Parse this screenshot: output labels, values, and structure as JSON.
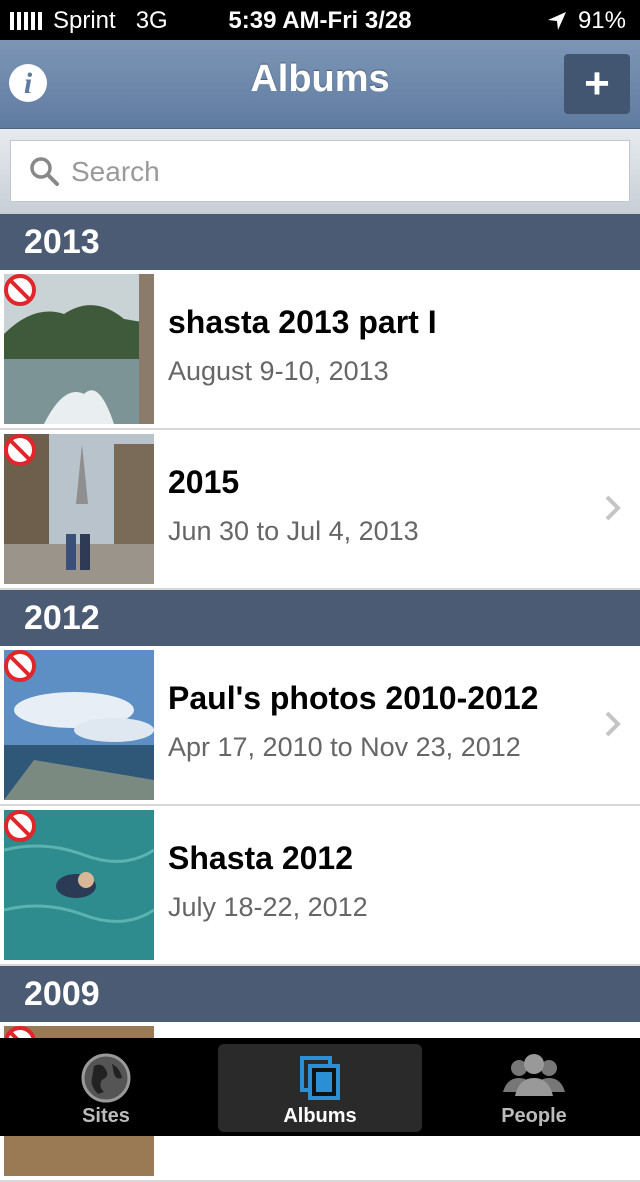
{
  "status_bar": {
    "carrier": "Sprint",
    "network": "3G",
    "time": "5:39 AM-Fri 3/28",
    "battery": "91%"
  },
  "nav": {
    "title": "Albums",
    "info_icon": "info-icon",
    "add_label": "+"
  },
  "search": {
    "placeholder": "Search"
  },
  "sections": [
    {
      "year": "2013",
      "albums": [
        {
          "title": "shasta 2013 part I",
          "date": "August 9-10, 2013",
          "chevron": false,
          "thumb": "lake"
        },
        {
          "title": "2015",
          "date": "Jun 30 to Jul 4, 2013",
          "chevron": true,
          "thumb": "street"
        }
      ]
    },
    {
      "year": "2012",
      "albums": [
        {
          "title": "Paul's photos 2010-2012",
          "date": "Apr 17, 2010 to Nov 23, 2012",
          "chevron": true,
          "thumb": "ship"
        },
        {
          "title": "Shasta 2012",
          "date": "July 18-22, 2012",
          "chevron": false,
          "thumb": "swim"
        }
      ]
    },
    {
      "year": "2009",
      "albums": []
    }
  ],
  "tabs": [
    {
      "label": "Sites",
      "icon": "globe-icon",
      "active": false
    },
    {
      "label": "Albums",
      "icon": "albums-icon",
      "active": true
    },
    {
      "label": "People",
      "icon": "people-icon",
      "active": false
    }
  ],
  "colors": {
    "nav": "#6f89ad",
    "section": "#4a5b73",
    "accent": "#2b8fd6"
  }
}
